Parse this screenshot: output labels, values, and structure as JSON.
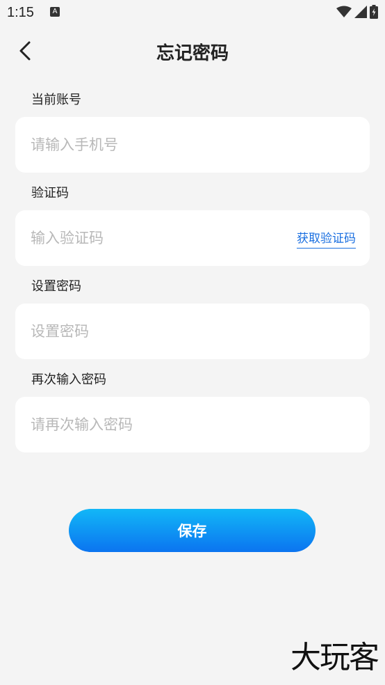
{
  "status_bar": {
    "time": "1:15",
    "app_icon_letter": "A",
    "icons": [
      "wifi-icon",
      "cellular-signal-icon",
      "battery-icon"
    ]
  },
  "header": {
    "title": "忘记密码",
    "back_icon": "chevron-left-icon"
  },
  "form": {
    "account": {
      "label": "当前账号",
      "placeholder": "请输入手机号",
      "value": ""
    },
    "code": {
      "label": "验证码",
      "placeholder": "输入验证码",
      "value": "",
      "get_code_label": "获取验证码"
    },
    "password": {
      "label": "设置密码",
      "placeholder": "设置密码",
      "value": ""
    },
    "confirm_password": {
      "label": "再次输入密码",
      "placeholder": "请再次输入密码",
      "value": ""
    }
  },
  "actions": {
    "save_label": "保存"
  },
  "watermark": {
    "text": "大玩客"
  },
  "colors": {
    "background": "#f4f4f4",
    "field_background": "#ffffff",
    "link_blue": "#1a6fe0",
    "button_gradient_top": "#12b7f7",
    "button_gradient_bottom": "#0b74f0",
    "placeholder": "#b8b8b8"
  }
}
